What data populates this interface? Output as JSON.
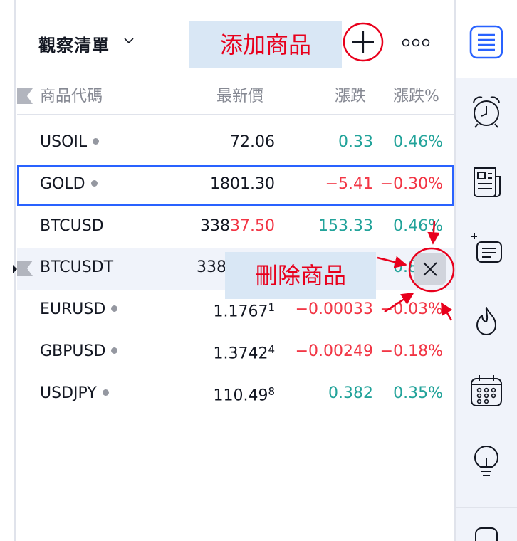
{
  "header": {
    "title": "觀察清單"
  },
  "columns": {
    "symbol": "商品代碼",
    "last": "最新價",
    "change": "漲跌",
    "change_pct": "漲跌%"
  },
  "rows": [
    {
      "symbol": "USOIL",
      "dot": true,
      "last": "72.06",
      "last_sup": "",
      "last_red": "",
      "change": "0.33",
      "change_pct": "0.46%",
      "dir": "up"
    },
    {
      "symbol": "GOLD",
      "dot": true,
      "last": "1801.30",
      "last_sup": "",
      "last_red": "",
      "change": "−5.41",
      "change_pct": "−0.30%",
      "dir": "down"
    },
    {
      "symbol": "BTCUSD",
      "dot": false,
      "last": "338",
      "last_sup": "",
      "last_red": "37.50",
      "change": "153.33",
      "change_pct": "0.46%",
      "dir": "up"
    },
    {
      "symbol": "BTCUSDT",
      "dot": false,
      "last": "338",
      "last_sup": "",
      "last_red": "",
      "change": "",
      "change_pct": "0.8",
      "dir": "up"
    },
    {
      "symbol": "EURUSD",
      "dot": true,
      "last": "1.1767",
      "last_sup": "1",
      "last_red": "",
      "change": "−0.00033",
      "change_pct": "−0.03%",
      "dir": "down"
    },
    {
      "symbol": "GBPUSD",
      "dot": true,
      "last": "1.3742",
      "last_sup": "4",
      "last_red": "",
      "change": "−0.00249",
      "change_pct": "−0.18%",
      "dir": "down"
    },
    {
      "symbol": "USDJPY",
      "dot": true,
      "last": "110.49",
      "last_sup": "8",
      "last_red": "",
      "change": "0.382",
      "change_pct": "0.35%",
      "dir": "up"
    }
  ],
  "annotations": {
    "add_label": "添加商品",
    "delete_label": "刪除商品"
  },
  "colors": {
    "up": "#22a39a",
    "down": "#f23645",
    "selected_border": "#2962ff",
    "annotation_red": "#e8001c",
    "annotation_bg": "#d9e7f5"
  },
  "sidebar_icons": [
    "watchlist-icon",
    "alarm-clock-icon",
    "news-icon",
    "ideas-stream-icon",
    "hotlist-flame-icon",
    "calendar-icon",
    "lightbulb-icon"
  ]
}
